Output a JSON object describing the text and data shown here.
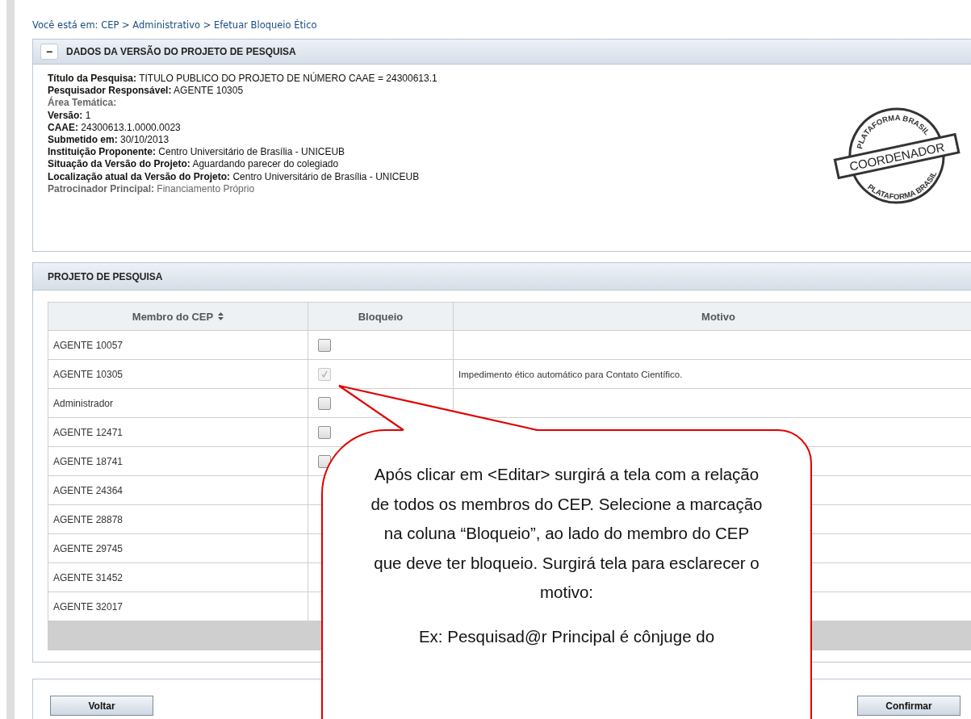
{
  "breadcrumb": "Você está em: CEP > Administrativo > Efetuar Bloqueio Ético",
  "project_panel": {
    "toggle": "−",
    "title": "DADOS DA VERSÃO DO PROJETO DE PESQUISA",
    "fields": [
      {
        "label": "Título da Pesquisa:",
        "value": "TITULO PUBLICO DO PROJETO DE NÚMERO CAAE = 24300613.1",
        "muted": false
      },
      {
        "label": "Pesquisador Responsável:",
        "value": "AGENTE 10305",
        "muted": false
      },
      {
        "label": "Área Temática:",
        "muted": true
      },
      {
        "label": "Versão:",
        "value": "1",
        "muted": false
      },
      {
        "label": "CAAE:",
        "value": "24300613.1.0000.0023",
        "muted": false
      },
      {
        "label": "Submetido em:",
        "value": "30/10/2013",
        "muted": false
      },
      {
        "label": "Instituição Proponente:",
        "value": "Centro Universitário de Brasília - UNICEUB",
        "muted": false
      },
      {
        "label": "Situação da Versão do Projeto:",
        "value": "Aguardando parecer do colegiado",
        "muted": false
      },
      {
        "label": "Localização atual da Versão do Projeto:",
        "value": "Centro Universitário de Brasília - UNICEUB",
        "muted": false
      },
      {
        "label": "Patrocinador Principal:",
        "value": "Financiamento Próprio",
        "muted": true
      }
    ],
    "stamp": {
      "ring_top": "PLATAFORMA BRASIL",
      "label": "COORDENADOR",
      "ring_bottom": "PLATAFORMA BRASIL"
    }
  },
  "members_panel": {
    "title": "PROJETO DE PESQUISA",
    "columns": [
      "Membro do CEP",
      "Bloqueio",
      "Motivo"
    ],
    "rows": [
      {
        "member": "AGENTE 10057",
        "kind": "checkbox",
        "checked": false,
        "disabled": false
      },
      {
        "member": "AGENTE 10305",
        "kind": "checkbox",
        "checked": true,
        "disabled": true,
        "reason": "Impedimento ético automático para Contato Científico."
      },
      {
        "member": "Administrador",
        "kind": "checkbox",
        "checked": false,
        "disabled": false
      },
      {
        "member": "AGENTE 12471",
        "kind": "checkbox",
        "checked": false,
        "disabled": false
      },
      {
        "member": "AGENTE 18741",
        "kind": "checkbox",
        "checked": false,
        "disabled": false
      },
      {
        "member": "AGENTE 24364"
      },
      {
        "member": "AGENTE 28878"
      },
      {
        "member": "AGENTE 29745"
      },
      {
        "member": "AGENTE 31452"
      },
      {
        "member": "AGENTE 32017"
      }
    ]
  },
  "buttons": [
    "Voltar",
    "Confirmar"
  ],
  "callout": {
    "paragraphs": [
      "Após clicar em <Editar> surgirá a tela com a relação de todos os membros do CEP. Selecione a marcação na coluna “Bloqueio”, ao lado do membro do CEP que deve ter bloqueio. Surgirá tela para esclarecer o motivo:",
      "Ex: Pesquisad@r Principal é cônjuge do"
    ]
  }
}
